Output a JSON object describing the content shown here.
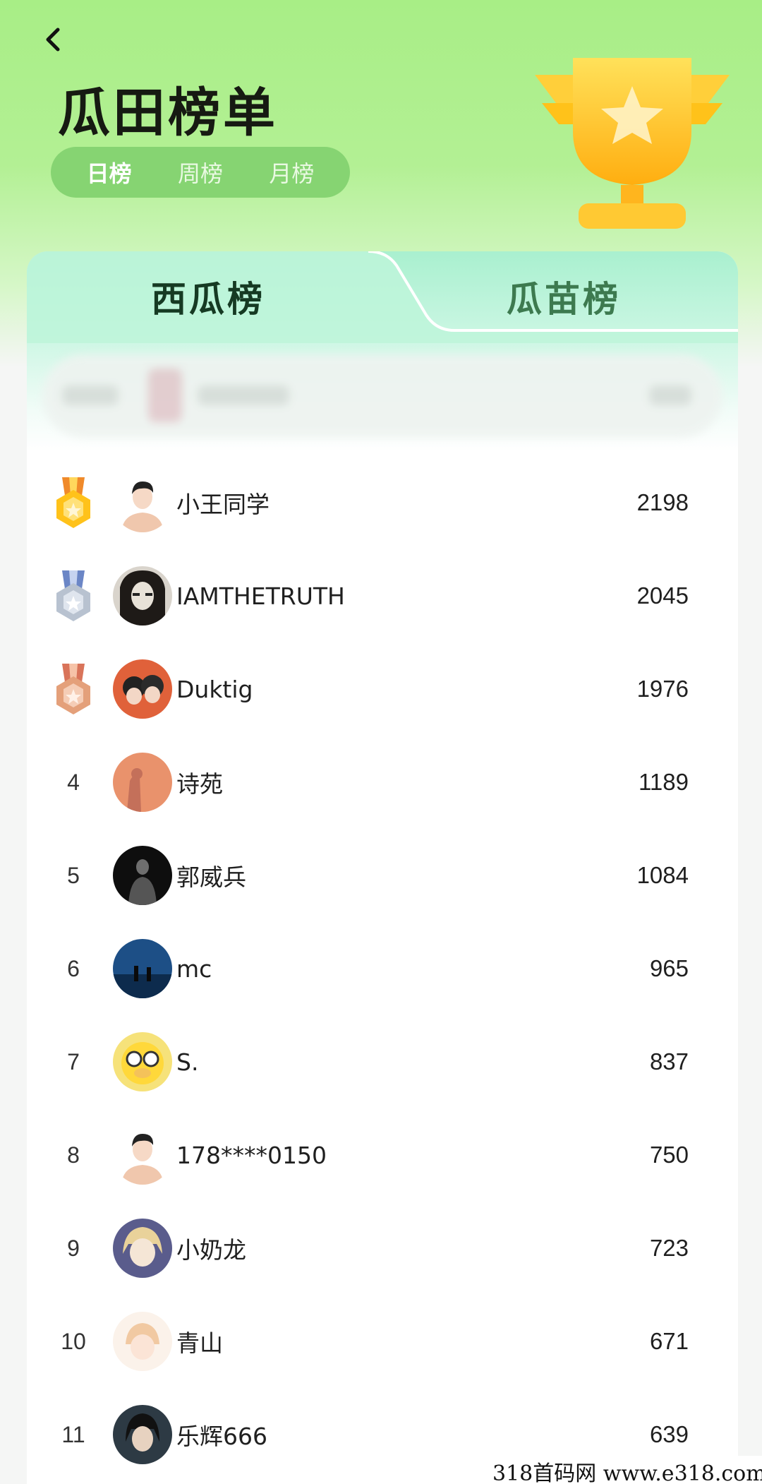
{
  "header": {
    "title": "瓜田榜单",
    "period_tabs": [
      "日榜",
      "周榜",
      "月榜"
    ],
    "active_period": "日榜"
  },
  "board_tabs": {
    "left": "西瓜榜",
    "right": "瓜苗榜",
    "active": "西瓜榜"
  },
  "colors": {
    "accent_green": "#86d472",
    "gold": "#ffc21a",
    "silver": "#b8c2d0",
    "bronze": "#e4a07a"
  },
  "ranking": [
    {
      "rank": "1",
      "name": "小王同学",
      "score": "2198",
      "medal": "gold-medal-icon",
      "avatar": "default"
    },
    {
      "rank": "2",
      "name": "IAMTHETRUTH",
      "score": "2045",
      "medal": "silver-medal-icon",
      "avatar": "dark"
    },
    {
      "rank": "3",
      "name": "Duktig",
      "score": "1976",
      "medal": "bronze-medal-icon",
      "avatar": "orange"
    },
    {
      "rank": "4",
      "name": "诗苑",
      "score": "1189",
      "avatar": "peach"
    },
    {
      "rank": "5",
      "name": "郭威兵",
      "score": "1084",
      "avatar": "black"
    },
    {
      "rank": "6",
      "name": "mc",
      "score": "965",
      "avatar": "blue"
    },
    {
      "rank": "7",
      "name": "S.",
      "score": "837",
      "avatar": "yellow"
    },
    {
      "rank": "8",
      "name": "178****0150",
      "score": "750",
      "avatar": "default"
    },
    {
      "rank": "9",
      "name": "小奶龙",
      "score": "723",
      "avatar": "purple"
    },
    {
      "rank": "10",
      "name": "青山",
      "score": "671",
      "avatar": "pale"
    },
    {
      "rank": "11",
      "name": "乐辉666",
      "score": "639",
      "avatar": "navy"
    }
  ],
  "watermark": "318首码网  www.e318.com"
}
